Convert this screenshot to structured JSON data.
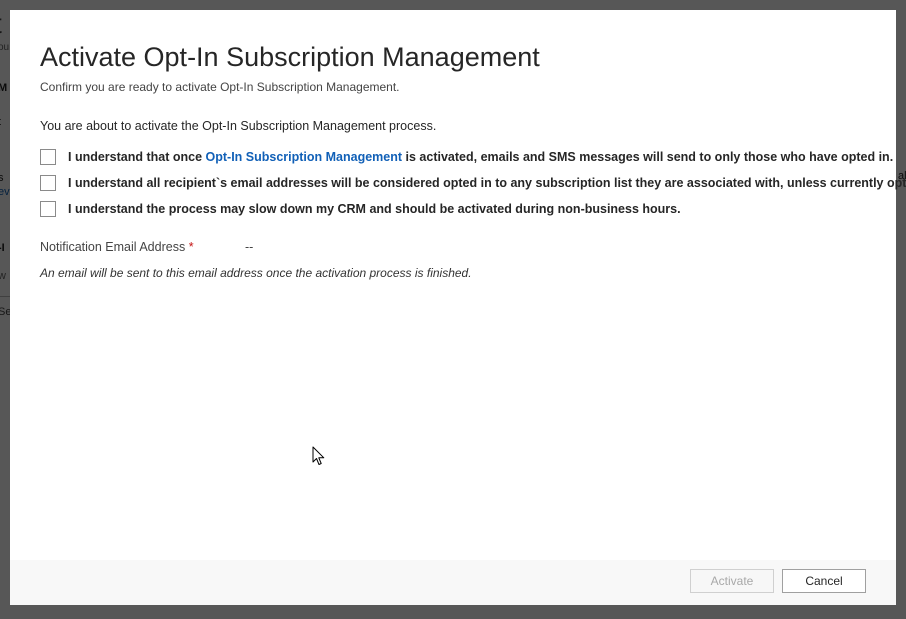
{
  "background": {
    "title_fragment": "t",
    "subtitle_fragment": "ou",
    "heading_fragment": "M",
    "fragment_b": "t",
    "fragment_c": "s",
    "fragment_d": "ev",
    "heading_fragment_2": "-I",
    "fragment_f": "w",
    "fragment_g": "Se",
    "right_fragment": "ala"
  },
  "dialog": {
    "title": "Activate Opt-In Subscription Management",
    "subtitle": "Confirm you are ready to activate Opt-In Subscription Management.",
    "intro": "You are about to activate the Opt-In Subscription Management process.",
    "checkboxes": [
      {
        "prefix": "I understand that once ",
        "link": "Opt-In Subscription Management",
        "suffix": " is activated, emails and SMS messages will send to only those who have opted in.",
        "checked": false
      },
      {
        "text": "I understand all recipient`s email addresses will be considered opted in to any subscription list they are associated with, unless currently opted out.",
        "checked": false
      },
      {
        "text": "I understand the process may slow down my CRM and should be activated during non-business hours.",
        "checked": false
      }
    ],
    "notification_field": {
      "label": "Notification Email Address",
      "required_marker": "*",
      "value": "--",
      "note": "An email will be sent to this email address once the activation process is finished."
    },
    "footer": {
      "activate_label": "Activate",
      "activate_enabled": false,
      "cancel_label": "Cancel"
    }
  },
  "colors": {
    "link": "#1160b7",
    "required": "#c41212",
    "overlay": "#4a4a4a"
  },
  "icons": {
    "cursor": "mouse-pointer-icon"
  }
}
